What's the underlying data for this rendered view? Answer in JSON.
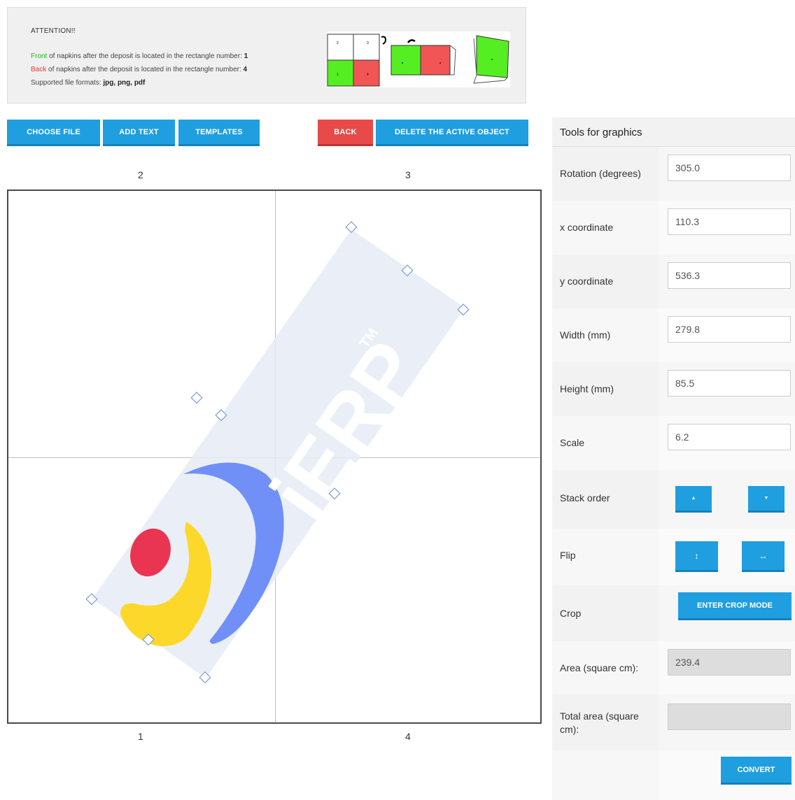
{
  "attention": {
    "title": "ATTENTION!!",
    "front_word": "Front",
    "front_text": " of napkins after the deposit is located in the rectangle number: ",
    "front_number": "1",
    "back_word": "Back",
    "back_text": " of napkins after the deposit is located in the rectangle number: ",
    "back_number": "4",
    "formats_label": "Supported file formats: ",
    "formats_value": "jpg, png, pdf",
    "illustration_numbers": [
      "2",
      "3",
      "1",
      "4"
    ]
  },
  "toolbar": {
    "choose_file": "CHOOSE FILE",
    "add_text": "ADD TEXT",
    "templates": "TEMPLATES",
    "back": "BACK",
    "delete_active": "DELETE THE ACTIVE OBJECT"
  },
  "canvas": {
    "top_labels": [
      "2",
      "3"
    ],
    "bottom_labels": [
      "1",
      "4"
    ],
    "object_text": "jERP",
    "object_trademark": "TM"
  },
  "tools": {
    "header": "Tools for graphics",
    "rotation_label": "Rotation (degrees)",
    "rotation_value": "305.0",
    "x_label": "x coordinate",
    "x_value": "110.3",
    "y_label": "y coordinate",
    "y_value": "536.3",
    "width_label": "Width (mm)",
    "width_value": "279.8",
    "height_label": "Height (mm)",
    "height_value": "85.5",
    "scale_label": "Scale",
    "scale_value": "6.2",
    "stack_label": "Stack order",
    "stack_up_icon": "▲",
    "stack_down_icon": "▼",
    "flip_label": "Flip",
    "flip_vertical_icon": "↕",
    "flip_horizontal_icon": "↔",
    "crop_label": "Crop",
    "crop_button": "ENTER CROP MODE",
    "area_label": "Area (square cm):",
    "area_value": "239.4",
    "total_area_label": "Total area (square cm):",
    "total_area_value": "",
    "convert_button": "CONVERT"
  },
  "colors": {
    "primary_button": "#1f9fe0",
    "danger_button": "#e84a4a",
    "front_green": "#22bb22",
    "back_red": "#e03a3a",
    "panel_green": "#55ee22",
    "panel_red": "#f25555"
  }
}
